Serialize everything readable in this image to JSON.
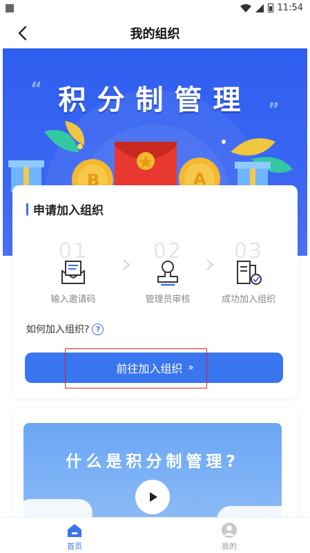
{
  "status_bar": {
    "time": "11:54",
    "icons": [
      "wifi-icon",
      "signal-icon",
      "battery-icon"
    ]
  },
  "nav": {
    "title": "我的组织",
    "back_icon": "back-arrow-icon"
  },
  "banner": {
    "title": "积分制管理",
    "colors": {
      "background": "#3a66f2",
      "coin": "#f5b82e",
      "envelope": "#e9382f"
    }
  },
  "apply_card": {
    "title": "申请加入组织",
    "steps": [
      {
        "number": "01",
        "label": "输入邀请码",
        "icon": "envelope-icon"
      },
      {
        "number": "02",
        "label": "管理员审核",
        "icon": "reviewer-icon"
      },
      {
        "number": "03",
        "label": "成功加入组织",
        "icon": "document-check-icon"
      }
    ],
    "how_to_join": "如何加入组织?",
    "help_icon": "question-icon",
    "join_button": "前往加入组织",
    "join_button_chevron": "››",
    "accent_color": "#3a76f0"
  },
  "video_card": {
    "title": "什么是积分制管理?",
    "play_icon": "play-icon"
  },
  "tabbar": {
    "tabs": [
      {
        "label": "首页",
        "icon": "home-icon",
        "active": true
      },
      {
        "label": "我的",
        "icon": "profile-icon",
        "active": false
      }
    ],
    "active_color": "#3a76f0",
    "inactive_color": "#999999"
  }
}
